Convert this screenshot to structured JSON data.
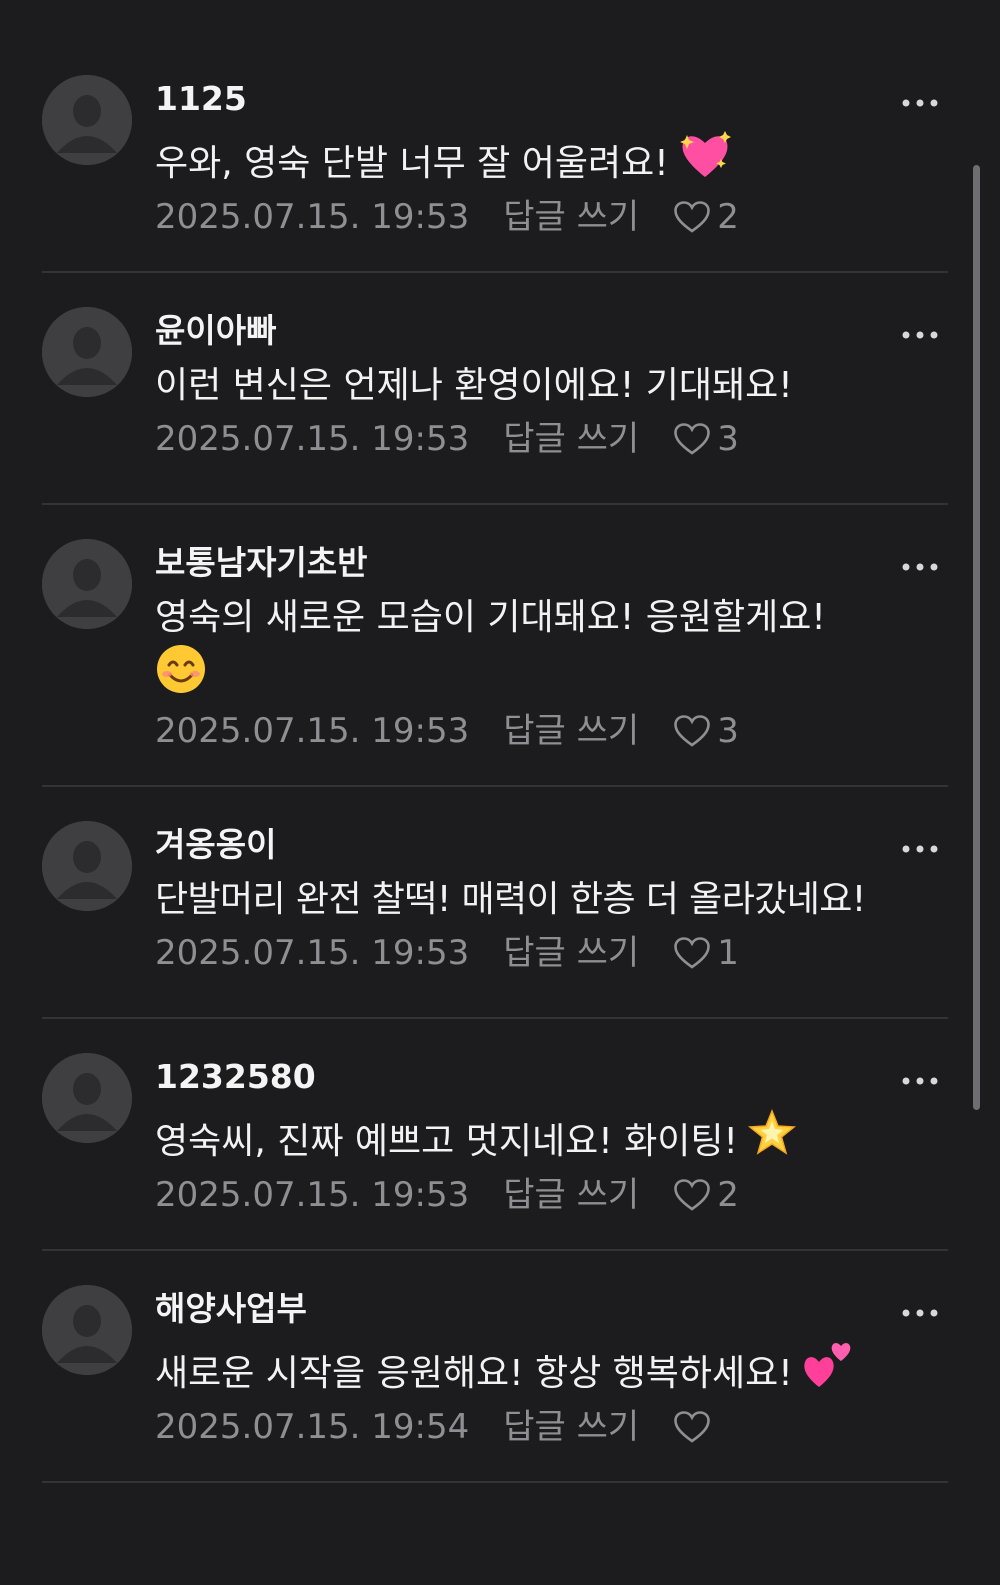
{
  "comments": [
    {
      "username": "1125",
      "text": "우와, 영숙 단발 너무 잘 어울려요!",
      "emoji": "sparkling-heart",
      "timestamp": "2025.07.15. 19:53",
      "reply_label": "답글 쓰기",
      "likes": "2"
    },
    {
      "username": "윤이아빠",
      "text": "이런 변신은 언제나 환영이에요! 기대돼요!",
      "emoji": "",
      "timestamp": "2025.07.15. 19:53",
      "reply_label": "답글 쓰기",
      "likes": "3"
    },
    {
      "username": "보통남자기초반",
      "text": "영숙의 새로운 모습이 기대돼요! 응원할게요!",
      "emoji": "smiling-face",
      "timestamp": "2025.07.15. 19:53",
      "reply_label": "답글 쓰기",
      "likes": "3"
    },
    {
      "username": "겨옹옹이",
      "text": "단발머리 완전 찰떡! 매력이 한층 더 올라갔네요!",
      "emoji": "",
      "timestamp": "2025.07.15. 19:53",
      "reply_label": "답글 쓰기",
      "likes": "1"
    },
    {
      "username": "1232580",
      "text": "영숙씨, 진짜 예쁘고 멋지네요! 화이팅!",
      "emoji": "glowing-star",
      "timestamp": "2025.07.15. 19:53",
      "reply_label": "답글 쓰기",
      "likes": "2"
    },
    {
      "username": "해양사업부",
      "text": "새로운 시작을 응원해요! 항상 행복하세요!",
      "emoji": "two-hearts",
      "timestamp": "2025.07.15. 19:54",
      "reply_label": "답글 쓰기",
      "likes": ""
    }
  ],
  "colors": {
    "background": "#1c1c1e",
    "text_primary": "#f2f2f2",
    "text_secondary": "#8e8e93",
    "avatar": "#3f3f42",
    "divider": "#333335"
  },
  "icons": {
    "avatar": "default-user-avatar-icon",
    "more": "more-horizontal-icon",
    "like": "heart-outline-icon"
  }
}
